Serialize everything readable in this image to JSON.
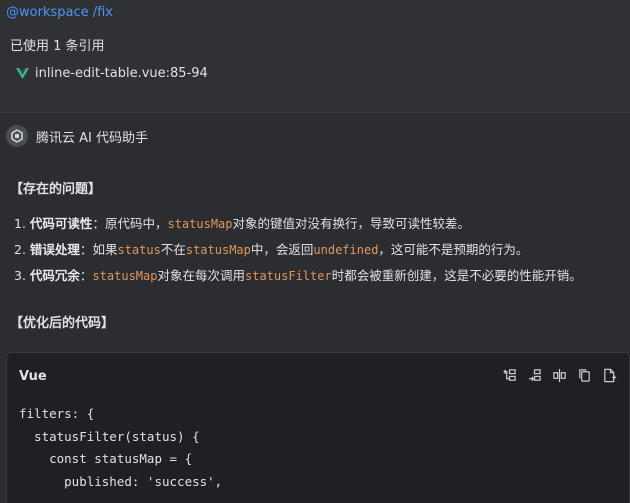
{
  "user_message": {
    "mention": "@workspace /fix",
    "reference_count": "已使用 1 条引用",
    "reference_file": "inline-edit-table.vue:85-94"
  },
  "assistant": {
    "name": "腾讯云 AI 代码助手",
    "issues_title": "【存在的问题】",
    "issues": [
      {
        "index": "1.",
        "label": "代码可读性",
        "sep": "：",
        "t1": "原代码中，",
        "c1": "statusMap",
        "t2": "对象的键值对没有换行，导致可读性较差。",
        "c2": "",
        "t3": "",
        "c3": "",
        "t4": ""
      },
      {
        "index": "2.",
        "label": "错误处理",
        "sep": "：",
        "t1": "如果",
        "c1": "status",
        "t2": "不在",
        "c2": "statusMap",
        "t3": "中，会返回",
        "c3": "undefined",
        "t4": "，这可能不是预期的行为。"
      },
      {
        "index": "3.",
        "label": "代码冗余",
        "sep": "：",
        "t1": "",
        "c1": "statusMap",
        "t2": "对象在每次调用",
        "c2": "statusFilter",
        "t3": "时都会被重新创建，这是不必要的性能开销。",
        "c3": "",
        "t4": ""
      }
    ],
    "optimized_title": "【优化后的代码】"
  },
  "code_block": {
    "language": "Vue",
    "lines": [
      "filters: {",
      "  statusFilter(status) {",
      "    const statusMap = {",
      "      published: 'success',"
    ]
  },
  "colors": {
    "background": "#2b2d30",
    "link": "#4e94f8",
    "inline_code": "#e0965a",
    "vue_green": "#41b883"
  }
}
